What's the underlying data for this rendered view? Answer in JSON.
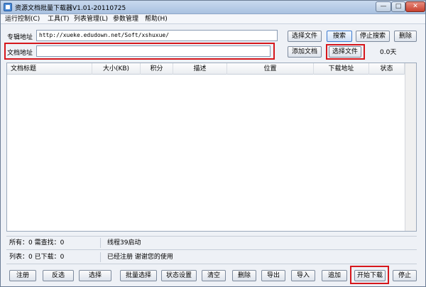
{
  "window": {
    "title": "资源文档批量下载器V1.01-20110725",
    "min_label": "—",
    "max_label": "□",
    "close_label": "✕"
  },
  "menu": [
    {
      "label": "运行控制(C)"
    },
    {
      "label": "工具(T)"
    },
    {
      "label": "列表管理(L)"
    },
    {
      "label": "参数管理"
    },
    {
      "label": "帮助(H)"
    }
  ],
  "album": {
    "label": "专辑地址",
    "value": "http://xueke.edudown.net/Soft/xshuxue/",
    "select_file_label": "选择文件",
    "search_label": "搜索",
    "stop_search_label": "停止搜索",
    "delete_label": "删除"
  },
  "doc": {
    "label": "文档地址",
    "value": "",
    "add_doc_label": "添加文档",
    "select_file_label": "选择文件",
    "days": "0.0天"
  },
  "table": {
    "columns": [
      "文档标题",
      "大小(KB)",
      "积分",
      "描述",
      "位置",
      "下载地址",
      "状态"
    ],
    "rows": []
  },
  "status": {
    "all": "所有：0 需查找：0",
    "list": "列表：0 已下载：0",
    "thread": "线程39启动",
    "registered": "已经注册 谢谢您的使用"
  },
  "buttons": {
    "register": "注册",
    "invert": "反选",
    "select": "选择",
    "batch_select": "批量选择",
    "status_settings": "状态设置",
    "clear": "清空",
    "delete": "删除",
    "export": "导出",
    "import": "导入",
    "append": "追加",
    "start_download": "开始下载",
    "stop": "停止"
  },
  "colors": {
    "highlight": "#d6171c",
    "title_bar": "#a9c1e0",
    "window_bg": "#eef1f6"
  }
}
